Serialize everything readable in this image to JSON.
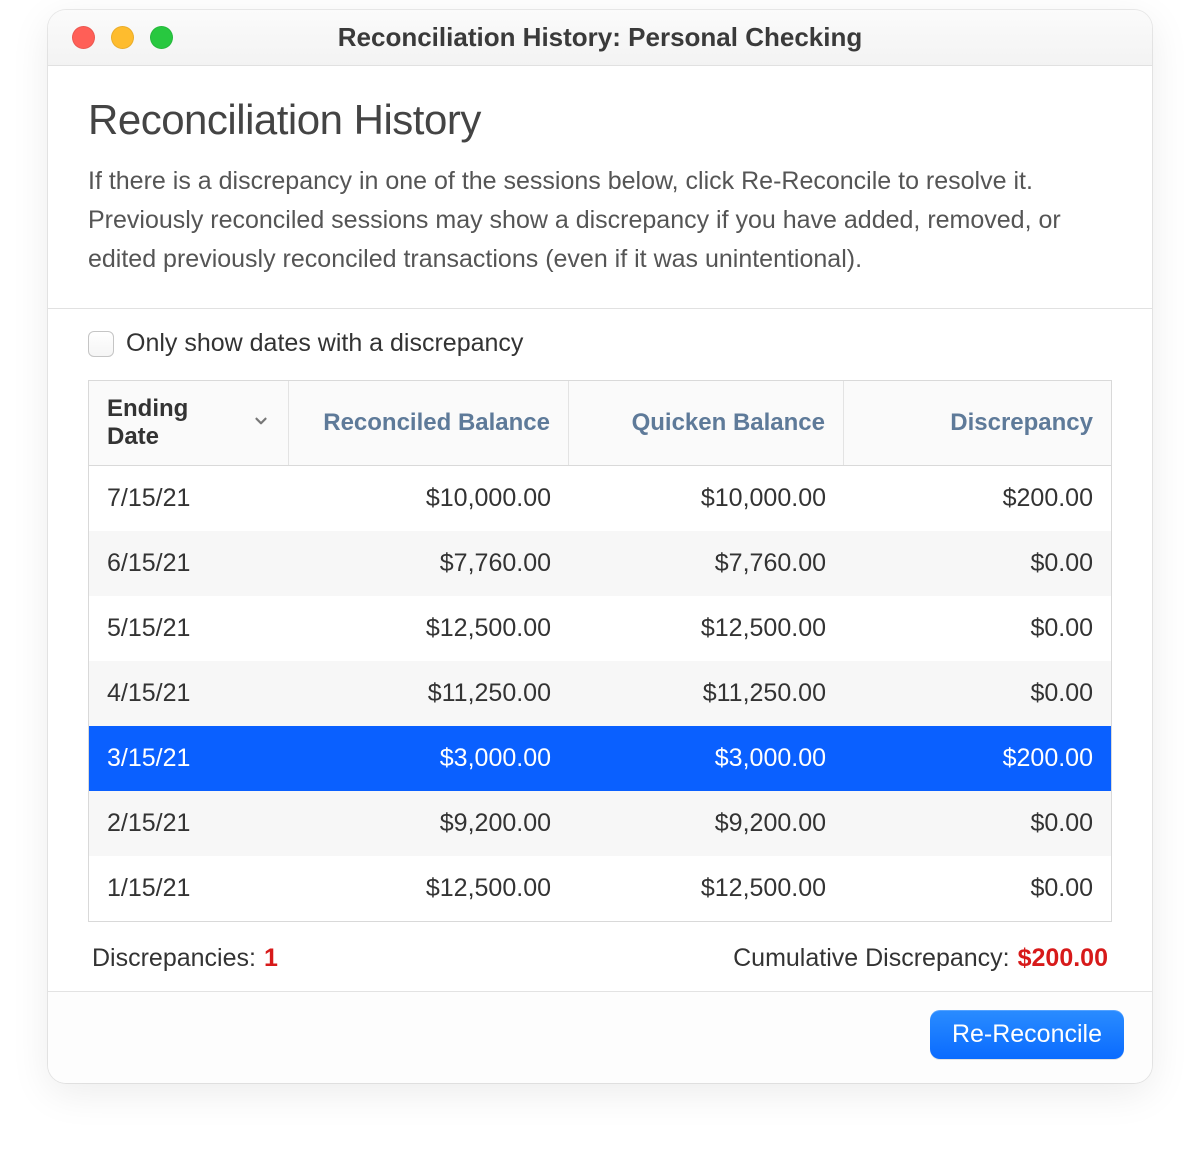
{
  "window": {
    "title": "Reconciliation History: Personal Checking"
  },
  "header": {
    "heading": "Reconciliation History",
    "description": "If there is a discrepancy in one of the sessions below, click Re-Reconcile to resolve it. Previously reconciled sessions may show a discrepancy if you have added, removed, or edited previously reconciled transactions (even if it was unintentional)."
  },
  "filter": {
    "only_discrepancies_label": "Only show dates with a discrepancy",
    "only_discrepancies_checked": false
  },
  "table": {
    "columns": {
      "ending_date": "Ending Date",
      "reconciled_balance": "Reconciled Balance",
      "quicken_balance": "Quicken Balance",
      "discrepancy": "Discrepancy"
    },
    "rows": [
      {
        "ending_date": "7/15/21",
        "reconciled_balance": "$10,000.00",
        "quicken_balance": "$10,000.00",
        "discrepancy": "$200.00",
        "selected": false
      },
      {
        "ending_date": "6/15/21",
        "reconciled_balance": "$7,760.00",
        "quicken_balance": "$7,760.00",
        "discrepancy": "$0.00",
        "selected": false
      },
      {
        "ending_date": "5/15/21",
        "reconciled_balance": "$12,500.00",
        "quicken_balance": "$12,500.00",
        "discrepancy": "$0.00",
        "selected": false
      },
      {
        "ending_date": "4/15/21",
        "reconciled_balance": "$11,250.00",
        "quicken_balance": "$11,250.00",
        "discrepancy": "$0.00",
        "selected": false
      },
      {
        "ending_date": "3/15/21",
        "reconciled_balance": "$3,000.00",
        "quicken_balance": "$3,000.00",
        "discrepancy": "$200.00",
        "selected": true
      },
      {
        "ending_date": "2/15/21",
        "reconciled_balance": "$9,200.00",
        "quicken_balance": "$9,200.00",
        "discrepancy": "$0.00",
        "selected": false
      },
      {
        "ending_date": "1/15/21",
        "reconciled_balance": "$12,500.00",
        "quicken_balance": "$12,500.00",
        "discrepancy": "$0.00",
        "selected": false
      }
    ]
  },
  "summary": {
    "discrepancies_label": "Discrepancies:",
    "discrepancies_count": "1",
    "cumulative_label": "Cumulative Discrepancy:",
    "cumulative_value": "$200.00"
  },
  "footer": {
    "re_reconcile_label": "Re-Reconcile"
  }
}
